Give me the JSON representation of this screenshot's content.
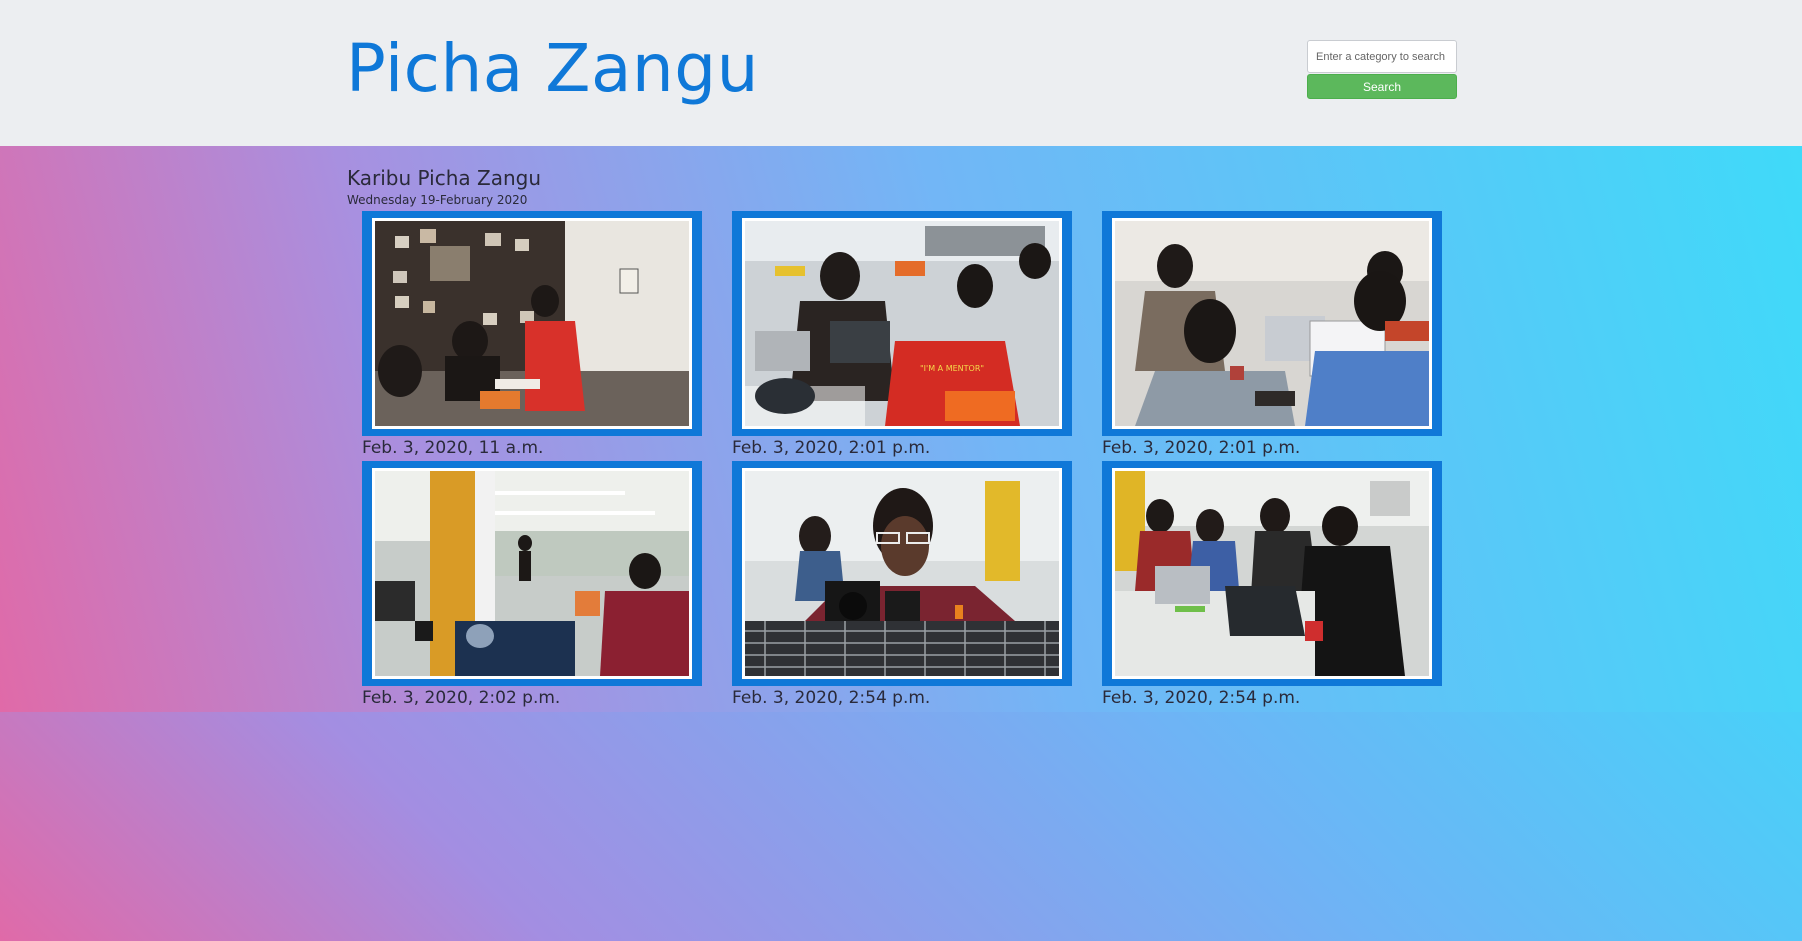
{
  "brand": {
    "title": "Picha Zangu"
  },
  "search": {
    "placeholder": "Enter a category to search",
    "button_label": "Search"
  },
  "main": {
    "welcome": "Karibu Picha Zangu",
    "date": "Wednesday 19-February 2020",
    "photos": [
      {
        "caption": "Feb. 3, 2020, 11 a.m."
      },
      {
        "caption": "Feb. 3, 2020, 2:01 p.m."
      },
      {
        "caption": "Feb. 3, 2020, 2:01 p.m."
      },
      {
        "caption": "Feb. 3, 2020, 2:02 p.m."
      },
      {
        "caption": "Feb. 3, 2020, 2:54 p.m."
      },
      {
        "caption": "Feb. 3, 2020, 2:54 p.m."
      }
    ]
  },
  "colors": {
    "brand": "#0f78d8",
    "navbar_bg": "#eceef1",
    "search_button": "#5cb85c",
    "frame": "#0f78d8"
  }
}
